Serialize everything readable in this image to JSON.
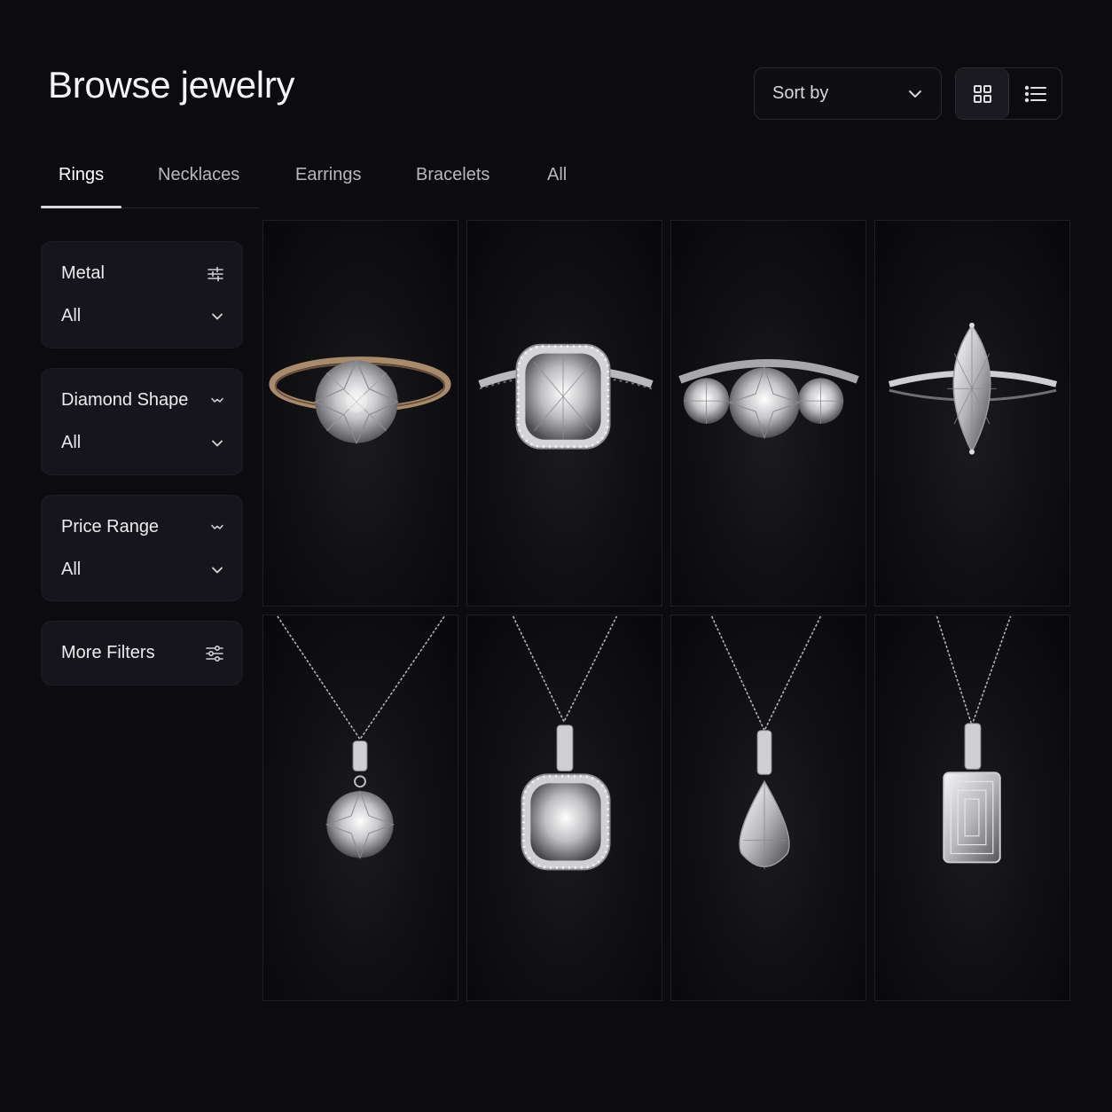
{
  "header": {
    "title": "Browse jewelry"
  },
  "sort": {
    "label": "Sort by"
  },
  "view_toggle": {
    "grid_icon": "grid-view-icon",
    "list_icon": "list-view-icon",
    "active": "grid"
  },
  "tabs": [
    {
      "label": "Rings",
      "active": true
    },
    {
      "label": "Necklaces",
      "active": false
    },
    {
      "label": "Earrings",
      "active": false
    },
    {
      "label": "Bracelets",
      "active": false
    },
    {
      "label": "All",
      "active": false
    }
  ],
  "filters": [
    {
      "label": "Metal",
      "icon": "sliders-icon",
      "value": "All"
    },
    {
      "label": "Diamond Shape",
      "icon": "chevron-down-icon",
      "value": "All"
    },
    {
      "label": "Price Range",
      "icon": "chevron-down-icon",
      "value": "All"
    }
  ],
  "more_filters": {
    "label": "More Filters",
    "icon": "sliders-icon"
  },
  "products": [
    {
      "kind": "ring",
      "stone": "round",
      "metal": "rose-gold"
    },
    {
      "kind": "ring",
      "stone": "cushion-halo",
      "metal": "white-gold"
    },
    {
      "kind": "ring",
      "stone": "three-stone",
      "metal": "white-gold"
    },
    {
      "kind": "ring",
      "stone": "marquise",
      "metal": "white-gold"
    },
    {
      "kind": "necklace",
      "stone": "round"
    },
    {
      "kind": "necklace",
      "stone": "cushion-halo"
    },
    {
      "kind": "necklace",
      "stone": "pear"
    },
    {
      "kind": "necklace",
      "stone": "emerald-cut"
    }
  ],
  "colors": {
    "background": "#0b0b10",
    "card": "#15151b",
    "text": "#e8e8ec",
    "muted": "#b7b7bd"
  }
}
